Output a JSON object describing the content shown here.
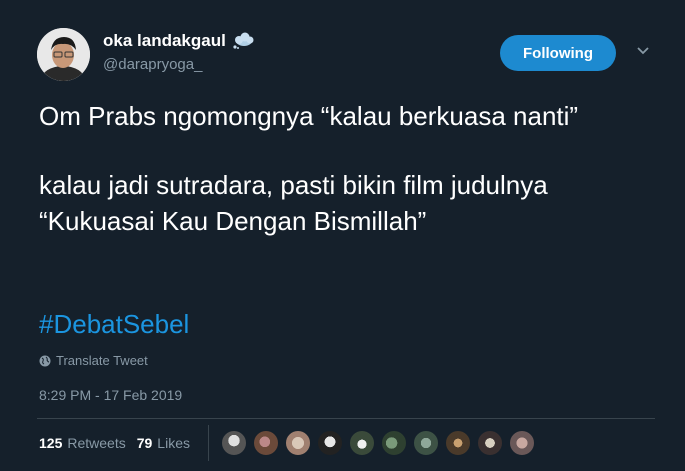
{
  "tweet": {
    "display_name": "oka landakgaul",
    "handle": "@darapryoga_",
    "follow_label": "Following",
    "text_line1": "Om Prabs ngomongnya “kalau berkuasa nanti”",
    "text_line2": "kalau jadi sutradara, pasti bikin film judulnya “Kukuasai Kau Dengan Bismillah”",
    "hashtag": "#DebatSebel",
    "translate_label": "Translate Tweet",
    "timestamp": "8:29 PM - 17 Feb 2019"
  },
  "stats": {
    "retweets_count": "125",
    "retweets_label": "Retweets",
    "likes_count": "79",
    "likes_label": "Likes"
  },
  "icons": {
    "name_badge": "cloud-icon",
    "menu": "chevron-down-icon",
    "translate": "globe-icon"
  },
  "colors": {
    "background": "#15202b",
    "accent": "#1b95e0",
    "follow_button": "#1d8ad0",
    "secondary_text": "#8899a6"
  }
}
